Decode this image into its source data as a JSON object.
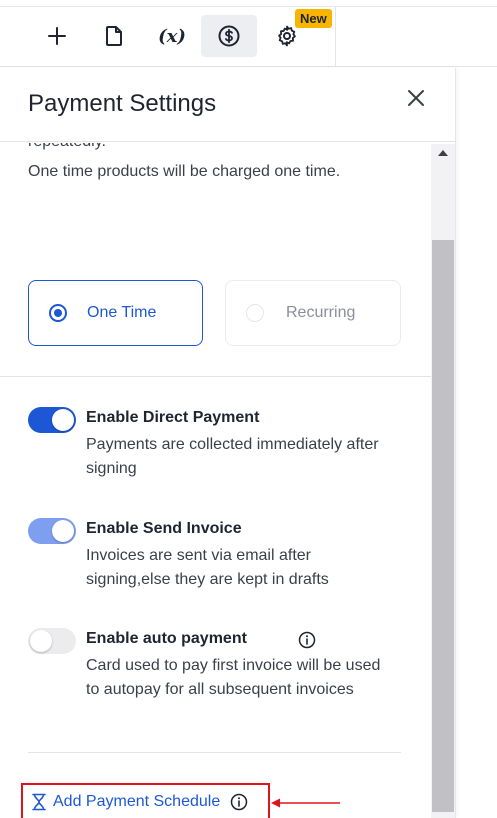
{
  "toolbar": {
    "buttons": [
      {
        "name": "add",
        "icon": "plus-icon"
      },
      {
        "name": "document",
        "icon": "document-icon"
      },
      {
        "name": "variables",
        "icon": "variable-icon",
        "glyph": "(x)"
      },
      {
        "name": "payments",
        "icon": "dollar-circle-icon",
        "active": true
      },
      {
        "name": "settings",
        "icon": "gear-icon"
      }
    ],
    "new_badge": "New"
  },
  "panel": {
    "title": "Payment Settings",
    "close_icon": "close-icon",
    "cut_text": "repeatedly.",
    "one_time_desc": "One time products will be charged one time.",
    "options": {
      "one_time": "One Time",
      "recurring": "Recurring",
      "selected": "One Time"
    },
    "toggles": [
      {
        "title": "Enable Direct Payment",
        "desc": "Payments are collected immediately after signing",
        "state": "on"
      },
      {
        "title": "Enable Send Invoice",
        "desc": "Invoices are sent via email after signing,else they are kept in drafts",
        "state": "on"
      },
      {
        "title": "Enable auto payment",
        "desc": "Card used to pay first invoice will be used to autopay for all subsequent invoices",
        "state": "off"
      }
    ],
    "schedule": {
      "label": "Add Payment Schedule",
      "icon": "hourglass-icon"
    }
  },
  "colors": {
    "accent": "#1e57d6",
    "badge": "#f7b500",
    "annotation": "#e0141c"
  }
}
